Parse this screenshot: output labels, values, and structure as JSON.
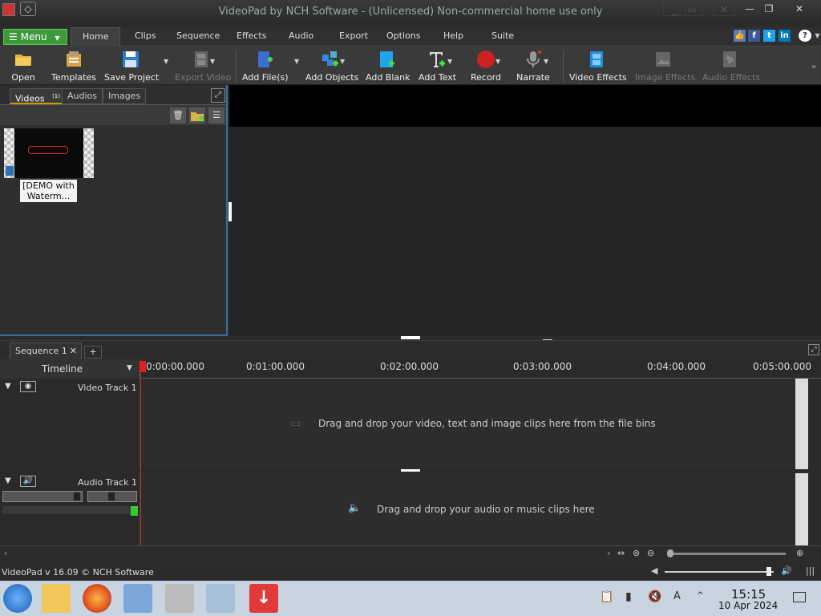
{
  "window": {
    "title": "VideoPad by NCH Software - (Unlicensed) Non-commercial home use only"
  },
  "menubar": {
    "menu_label": "Menu",
    "tabs": [
      "Home",
      "Clips",
      "Sequence",
      "Effects",
      "Audio",
      "Export",
      "Options",
      "Help",
      "Suite"
    ]
  },
  "toolbar": {
    "open": "Open",
    "templates": "Templates",
    "save_project": "Save Project",
    "export_video": "Export Video",
    "add_files": "Add File(s)",
    "add_objects": "Add Objects",
    "add_blank": "Add Blank",
    "add_text": "Add Text",
    "record": "Record",
    "narrate": "Narrate",
    "video_effects": "Video Effects",
    "image_effects": "Image Effects",
    "audio_effects": "Audio Effects"
  },
  "bin": {
    "tabs": [
      "Videos",
      "Audios",
      "Images"
    ],
    "videos_count": "(1)",
    "clip_label": "[DEMO with Waterm..."
  },
  "sequence": {
    "tab_label": "Sequence 1",
    "add_tab": "+",
    "timeline_label": "Timeline",
    "ticks": [
      "0:00:00.000",
      "0:01:00.000",
      "0:02:00.000",
      "0:03:00.000",
      "0:04:00.000",
      "0:05:00.000"
    ],
    "video_track_label": "Video Track 1",
    "audio_track_label": "Audio Track 1",
    "video_drop_text": "Drag and drop your video, text and image clips here from the file bins",
    "audio_drop_text": "Drag and drop your audio or music clips here"
  },
  "status": {
    "version": "VideoPad v 16.09 © NCH Software"
  },
  "taskbar": {
    "time": "15:15",
    "date": "10 Apr 2024"
  }
}
